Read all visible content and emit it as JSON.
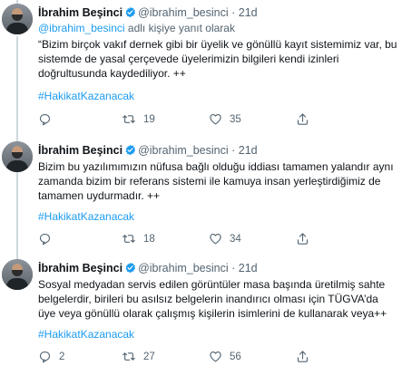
{
  "tweets": [
    {
      "name": "İbrahim Beşinci",
      "handle": "@ibrahim_besinci",
      "dot": "·",
      "time": "21d",
      "reply_mention": "@ibrahim_besinci",
      "reply_suffix": " adlı kişiye yanıt olarak",
      "text": "“Bizim birçok vakıf  dernek gibi bir üyelik ve gönüllü kayıt sistemimiz var, bu sistemde de yasal çerçevede üyelerimizin bilgileri kendi izinleri doğrultusunda kaydediliyor. ++",
      "hashtag": "#HakikatKazanacak",
      "replies": "",
      "retweets": "19",
      "likes": "35"
    },
    {
      "name": "İbrahim Beşinci",
      "handle": "@ibrahim_besinci",
      "dot": "·",
      "time": "21d",
      "text": "Bizim bu yazılımımızın nüfusa bağlı olduğu iddiası tamamen yalandır aynı zamanda bizim bir referans sistemi ile kamuya insan yerleştirdiğimiz de tamamen uydurmadır. ++",
      "hashtag": "#HakikatKazanacak",
      "replies": "",
      "retweets": "18",
      "likes": "34"
    },
    {
      "name": "İbrahim Beşinci",
      "handle": "@ibrahim_besinci",
      "dot": "·",
      "time": "21d",
      "text": "Sosyal medyadan servis edilen görüntüler masa başında üretilmiş sahte belgelerdir, birileri bu asılsız belgelerin inandırıcı olması için TÜGVA’da üye veya gönüllü olarak çalışmış kişilerin isimlerini de kullanarak veya++",
      "hashtag": "#HakikatKazanacak",
      "replies": "2",
      "retweets": "27",
      "likes": "56"
    }
  ],
  "icons": {
    "verified": "verified-badge-icon",
    "reply": "reply-icon",
    "retweet": "retweet-icon",
    "like": "heart-icon",
    "share": "share-icon",
    "more": "more-icon"
  },
  "colors": {
    "accent": "#1d9bf0",
    "secondary_text": "#536471",
    "thread_line": "#cfd9de"
  }
}
